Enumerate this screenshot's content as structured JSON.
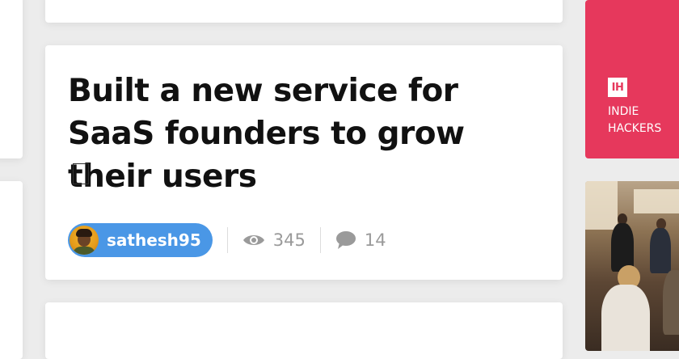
{
  "post": {
    "title": "Built a new service for SaaS founders to grow their users",
    "author": "sathesh95",
    "views": "345",
    "comments": "14"
  },
  "sponsor": {
    "logo_text": "IH",
    "name": "INDIE\nHACKERS"
  },
  "icons": {
    "views": "eye-icon",
    "comments": "speech-bubble-icon"
  },
  "colors": {
    "author_pill": "#4a97e6",
    "sponsor_bg": "#e6385c",
    "stat_text": "#9a9a9a"
  }
}
